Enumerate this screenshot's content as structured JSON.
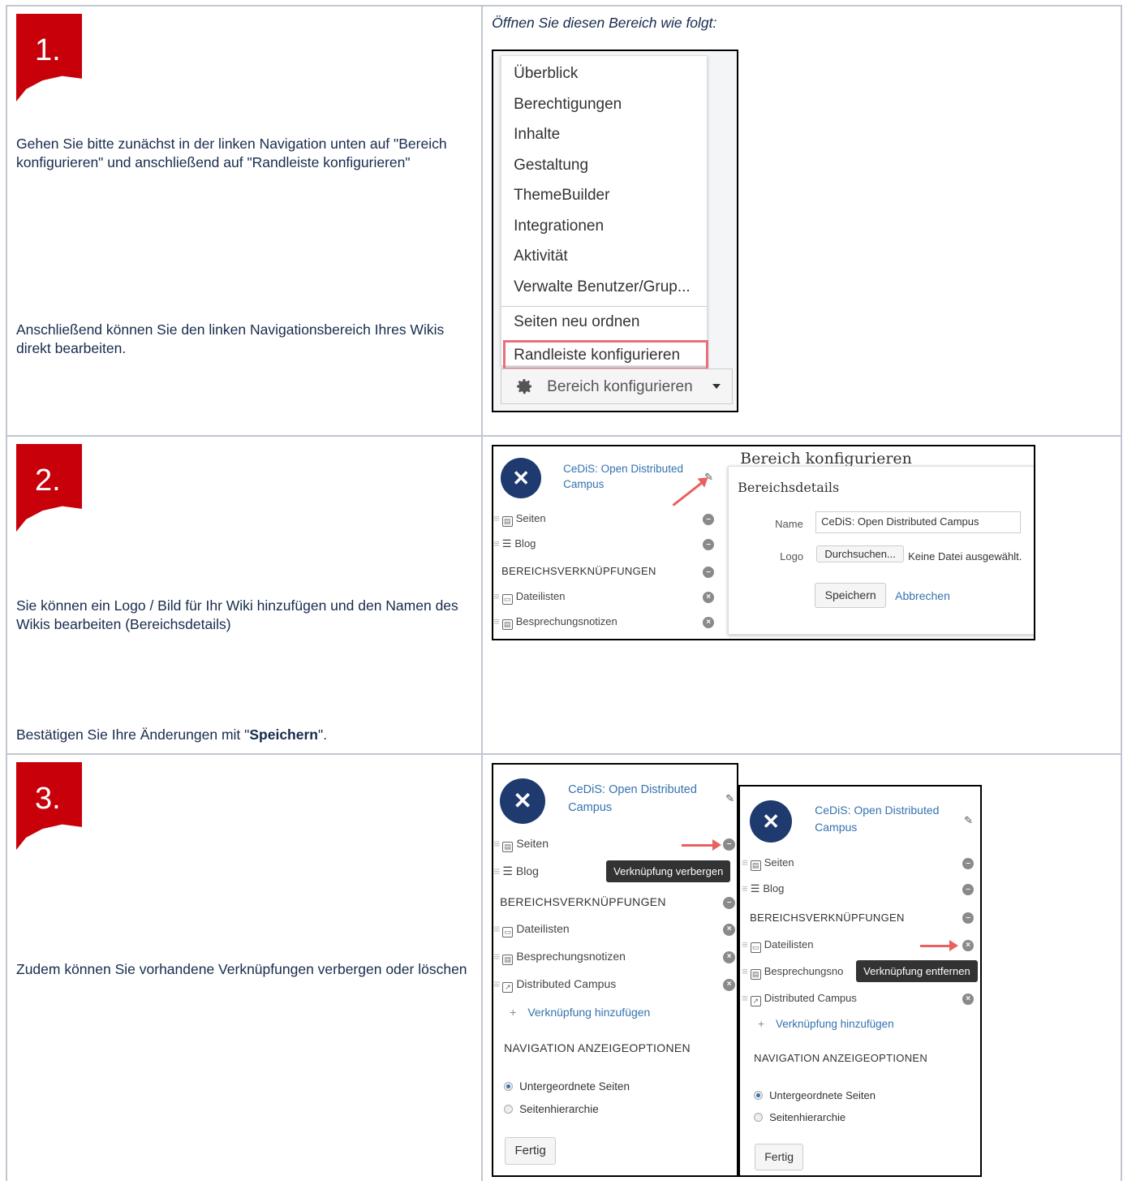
{
  "steps": [
    {
      "number": "1.",
      "text_a": "Gehen Sie bitte zunächst in der linken Navigation unten auf \"Bereich konfigurieren\" und anschließend auf \"Randleiste konfigurieren\"",
      "text_b": "Anschließend können Sie den linken Navigationsbereich Ihres Wikis direkt bearbeiten.",
      "caption": "Öffnen Sie diesen Bereich wie folgt:",
      "menu": {
        "items": [
          "Überblick",
          "Berechtigungen",
          "Inhalte",
          "Gestaltung",
          "ThemeBuilder",
          "Integrationen",
          "Aktivität",
          "Verwalte Benutzer/Grup..."
        ],
        "items_after_sep": [
          "Seiten neu ordnen",
          "Randleiste konfigurieren"
        ],
        "configure_button": "Bereich konfigurieren",
        "gear_icon": "gear-icon"
      }
    },
    {
      "number": "2.",
      "text_a": "Sie können ein Logo / Bild für Ihr Wiki hinzufügen und den Namen des Wikis bearbeiten (Bereichsdetails)",
      "text_b_pre": "Bestätigen Sie Ihre Änderungen mit \"",
      "text_b_bold": "Speichern",
      "text_b_post": "\".",
      "sidebar": {
        "space_name_1": "CeDiS: Open Distributed",
        "space_name_2": "Campus",
        "items": [
          "Seiten",
          "Blog"
        ],
        "section": "BEREICHSVERKNÜPFUNGEN",
        "links": [
          "Dateilisten",
          "Besprechungsnotizen"
        ]
      },
      "dialog": {
        "title": "Bereich konfigurieren",
        "panel_title": "Bereichsdetails",
        "name_label": "Name",
        "name_value": "CeDiS: Open Distributed Campus",
        "logo_label": "Logo",
        "browse_button": "Durchsuchen...",
        "no_file": "Keine Datei ausgewählt.",
        "save_button": "Speichern",
        "cancel_link": "Abbrechen"
      }
    },
    {
      "number": "3.",
      "text_a": "Zudem können Sie vorhandene Verknüpfungen verbergen oder löschen",
      "sidebar": {
        "space_name_1": "CeDiS: Open Distributed",
        "space_name_2": "Campus",
        "items": [
          "Seiten",
          "Blog"
        ],
        "section": "BEREICHSVERKNÜPFUNGEN",
        "links": [
          "Dateilisten",
          "Besprechungsnotizen",
          "Distributed Campus"
        ],
        "add_link": "Verknüpfung hinzufügen",
        "nav_options": "NAVIGATION ANZEIGEOPTIONEN",
        "radio_1": "Untergeordnete Seiten",
        "radio_2": "Seitenhierarchie",
        "done_button": "Fertig",
        "tooltip_hide": "Verknüpfung verbergen",
        "tooltip_remove": "Verknüpfung entfernen",
        "link_truncated": "Besprechungsno"
      }
    }
  ]
}
